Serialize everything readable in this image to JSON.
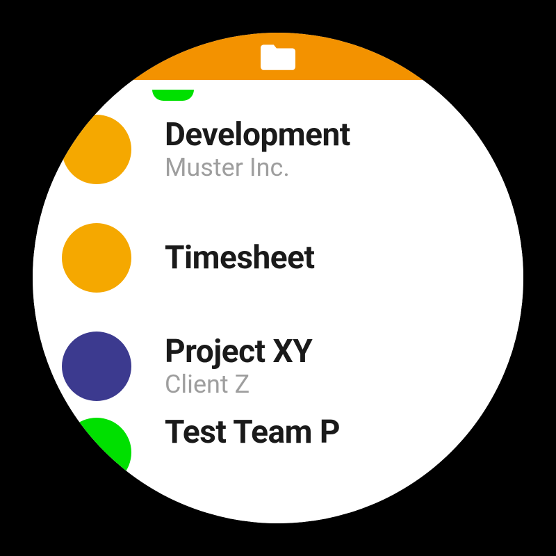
{
  "header": {
    "icon_name": "folder-icon"
  },
  "colors": {
    "header_bg": "#f39200",
    "green": "#00e000",
    "orange": "#f5a800",
    "purple": "#3c3a8f",
    "blue": "#3949ab",
    "text_primary": "#1a1a1a",
    "text_secondary": "#9e9e9e"
  },
  "items": [
    {
      "title": "",
      "subtitle": "",
      "color": "#00e000",
      "partial": "top"
    },
    {
      "title": "Development",
      "subtitle": "Muster Inc.",
      "color": "#f5a800"
    },
    {
      "title": "Timesheet",
      "subtitle": "",
      "color": "#f5a800"
    },
    {
      "title": "Project XY",
      "subtitle": "Client Z",
      "color": "#3c3a8f"
    },
    {
      "title": "Test Team P",
      "subtitle": "",
      "color": "#00e000",
      "partial": "bottom"
    }
  ]
}
